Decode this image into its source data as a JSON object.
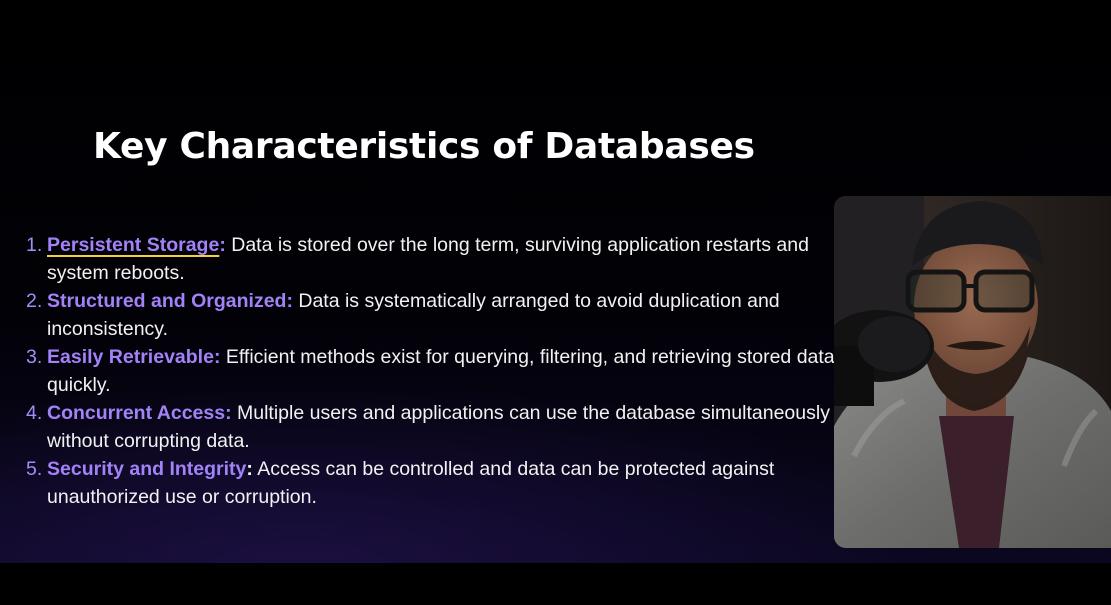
{
  "slide": {
    "title": "Key Characteristics of Databases",
    "items": [
      {
        "num": "1.",
        "term": "Persistent Storage",
        "colon": ":",
        "desc": " Data is stored over the long term, surviving application restarts and system reboots."
      },
      {
        "num": "2.",
        "term": "Structured and Organized",
        "colon": ":",
        "desc": " Data is systematically arranged to avoid duplication and inconsistency."
      },
      {
        "num": "3.",
        "term": "Easily Retrievable",
        "colon": ":",
        "desc": " Efficient methods exist for querying, filtering, and retrieving stored data quickly."
      },
      {
        "num": "4.",
        "term": "Concurrent Access",
        "colon": ":",
        "desc": " Multiple users and applications can use the database simultaneously without corrupting data."
      },
      {
        "num": "5.",
        "term": "Security and Integrity",
        "colon": ":",
        "desc": " Access can be controlled and data can be protected against unauthorized use or corruption."
      }
    ]
  },
  "colors": {
    "accent_term": "#a182f7",
    "underline": "#f1d23a",
    "text": "#f2f2f2",
    "background": "#000000"
  },
  "webcam": {
    "icon": "presenter-video-icon"
  }
}
